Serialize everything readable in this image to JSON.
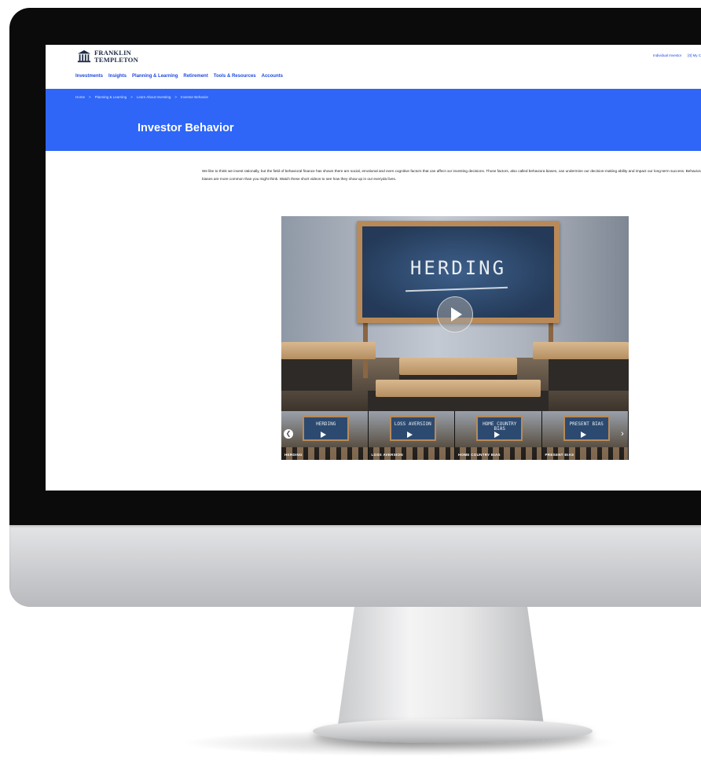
{
  "logo": {
    "line1": "FRANKLIN",
    "line2": "TEMPLETON"
  },
  "utility": {
    "individual_investor": "Individual Investor",
    "my_account": "[0] My C"
  },
  "nav": {
    "items": [
      "Investments",
      "Insights",
      "Planning & Learning",
      "Retirement",
      "Tools & Resources",
      "Accounts"
    ]
  },
  "breadcrumb": [
    "Home",
    ">",
    "Planning & Learning",
    ">",
    "Learn About Investing",
    ">",
    "Investor Behavior"
  ],
  "page": {
    "title": "Investor Behavior",
    "intro": "We like to think we invest rationally, but the field of behavioral finance has shown there are social, emotional and even cognitive factors that can affect our investing decisions. Those factors, also called behaviora biases, can undermine our decision-making ability and impact our long-term success. Behavioral biases are more common than you might think. Watch these short videos to see how they show up in our everyda lives."
  },
  "video": {
    "board_text": "HERDING"
  },
  "thumbnails": [
    {
      "board": "HERDING",
      "label": "HERDING"
    },
    {
      "board": "LOSS AVERSION",
      "label": "LOSS AVERSION"
    },
    {
      "board": "HOME COUNTRY BIAS",
      "label": "HOME COUNTRY BIAS"
    },
    {
      "board": "PRESENT BIAS",
      "label": "PRESENT BIAS"
    }
  ],
  "colors": {
    "brand_blue": "#2f66f7",
    "nav_blue": "#1f48e0"
  },
  "icons": {
    "prev": "chevron-left-icon",
    "next": "chevron-right-icon",
    "play": "play-icon"
  }
}
